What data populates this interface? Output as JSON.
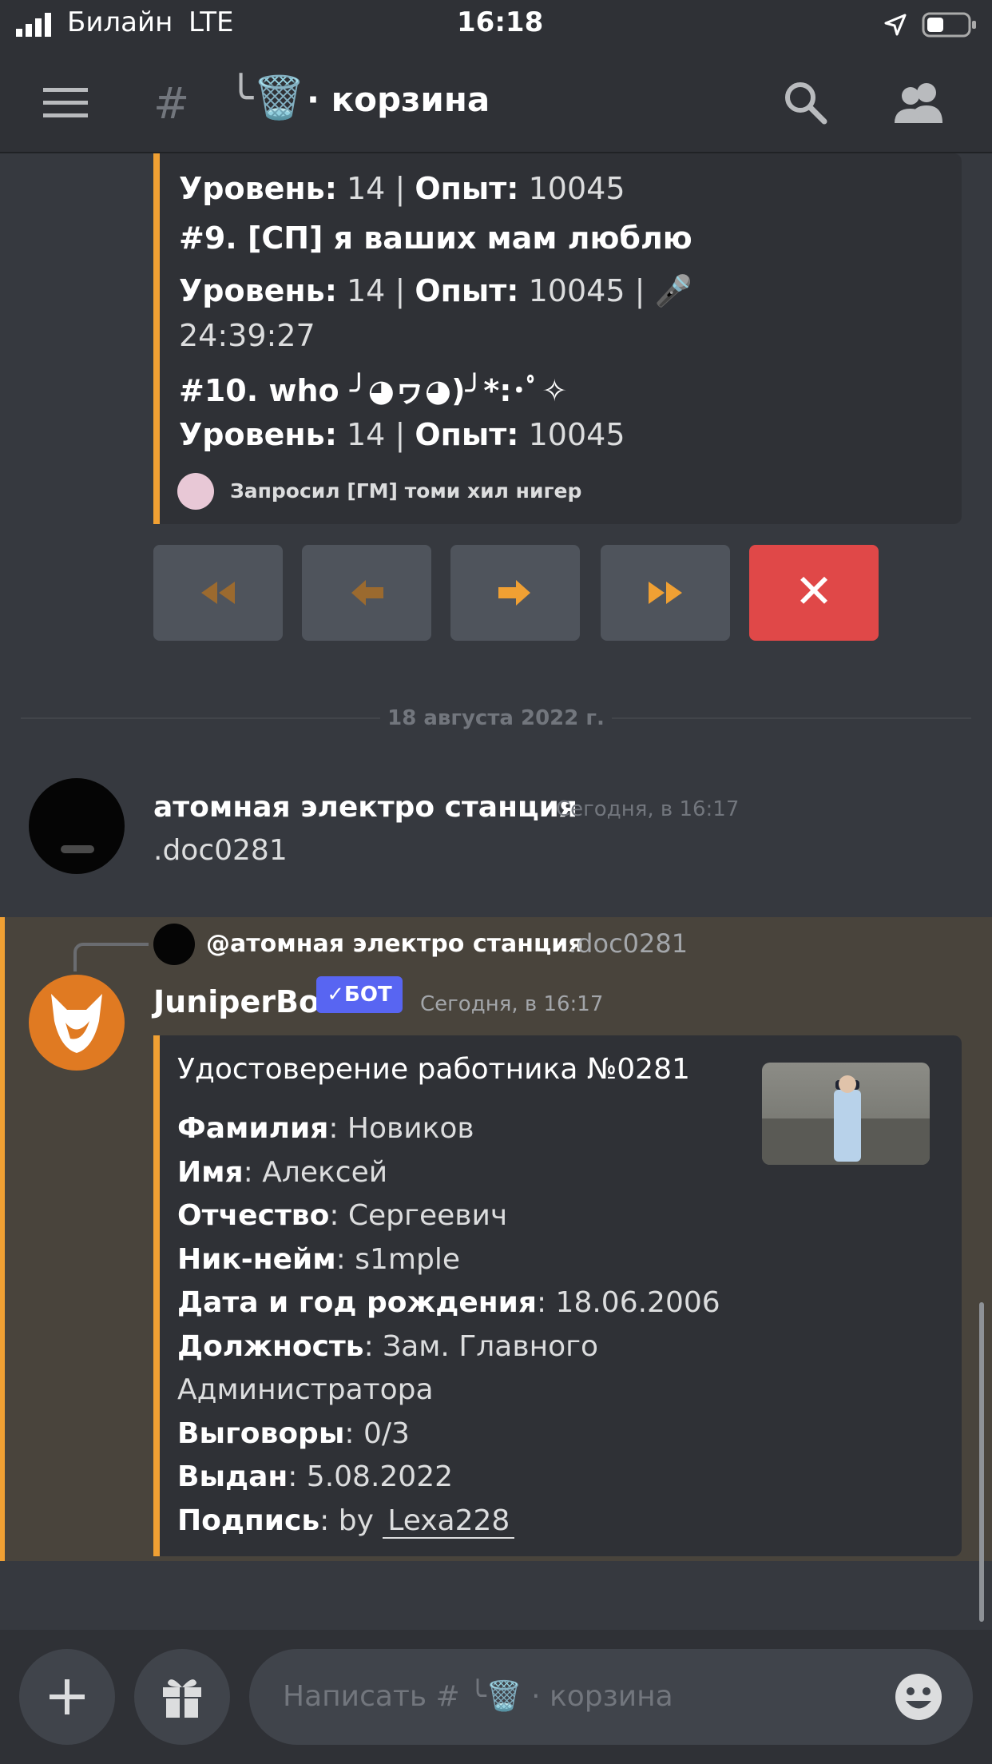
{
  "status_bar": {
    "carrier": "Билайн",
    "network": "LTE",
    "time": "16:18"
  },
  "header": {
    "hash": "#",
    "channel_prefix": "╰🗑️",
    "channel_name": "· корзина"
  },
  "leaderboard": {
    "top_line": {
      "level_label": "Уровень:",
      "level": "14",
      "sep": "|",
      "exp_label": "Опыт:",
      "exp": "10045"
    },
    "entries": [
      {
        "rank": "#9. [СП] я ваших мам люблю",
        "level_label": "Уровень:",
        "level": "14",
        "sep": "|",
        "exp_label": "Опыт:",
        "exp": "10045 | 🎤",
        "voice": "24:39:27"
      },
      {
        "rank": "#10. who ╯◕ヮ◕)╯*:･ﾟ✧",
        "level_label": "Уровень:",
        "level": "14",
        "sep": "|",
        "exp_label": "Опыт:",
        "exp": "10045"
      }
    ],
    "footer": "Запросил [ГМ]  томи хил нигер"
  },
  "nav_buttons": {
    "first": "first-page",
    "prev": "prev-page",
    "next": "next-page",
    "last": "last-page",
    "close": "✕"
  },
  "date_divider": "18 августа 2022 г.",
  "message1": {
    "author": "атомная электро станция",
    "timestamp": "Сегодня, в 16:17",
    "text": ".doc0281"
  },
  "message2": {
    "reply_author": "@атомная электро станция",
    "reply_text": ".doc0281",
    "author": "JuniperBot",
    "bot_tag": "✓БОТ",
    "timestamp": "Сегодня, в 16:17",
    "embed": {
      "title": "Удостоверение работника №0281",
      "fields": [
        {
          "label": "Фамилия",
          "value": ": Новиков"
        },
        {
          "label": "Имя",
          "value": ": Алексей"
        },
        {
          "label": "Отчество",
          "value": ": Сергеевич"
        },
        {
          "label": "Ник-нейм",
          "value": ": s1mple"
        },
        {
          "label": "Дата и год рождения",
          "value": ": 18.06.2006"
        },
        {
          "label": "Должность",
          "value": ": Зам. Главного"
        },
        {
          "label": "",
          "value": "Администратора"
        },
        {
          "label": "Выговоры",
          "value": ": 0/3"
        },
        {
          "label": "Выдан",
          "value": ": 5.08.2022"
        },
        {
          "label": "Подпись",
          "value": ": by "
        }
      ],
      "signature": "Lexa228"
    }
  },
  "composer": {
    "placeholder": "Написать # ╰🗑️ · корзина"
  },
  "colors": {
    "accent": "#f0a033",
    "danger": "#e04848",
    "blurple": "#5865f2"
  }
}
